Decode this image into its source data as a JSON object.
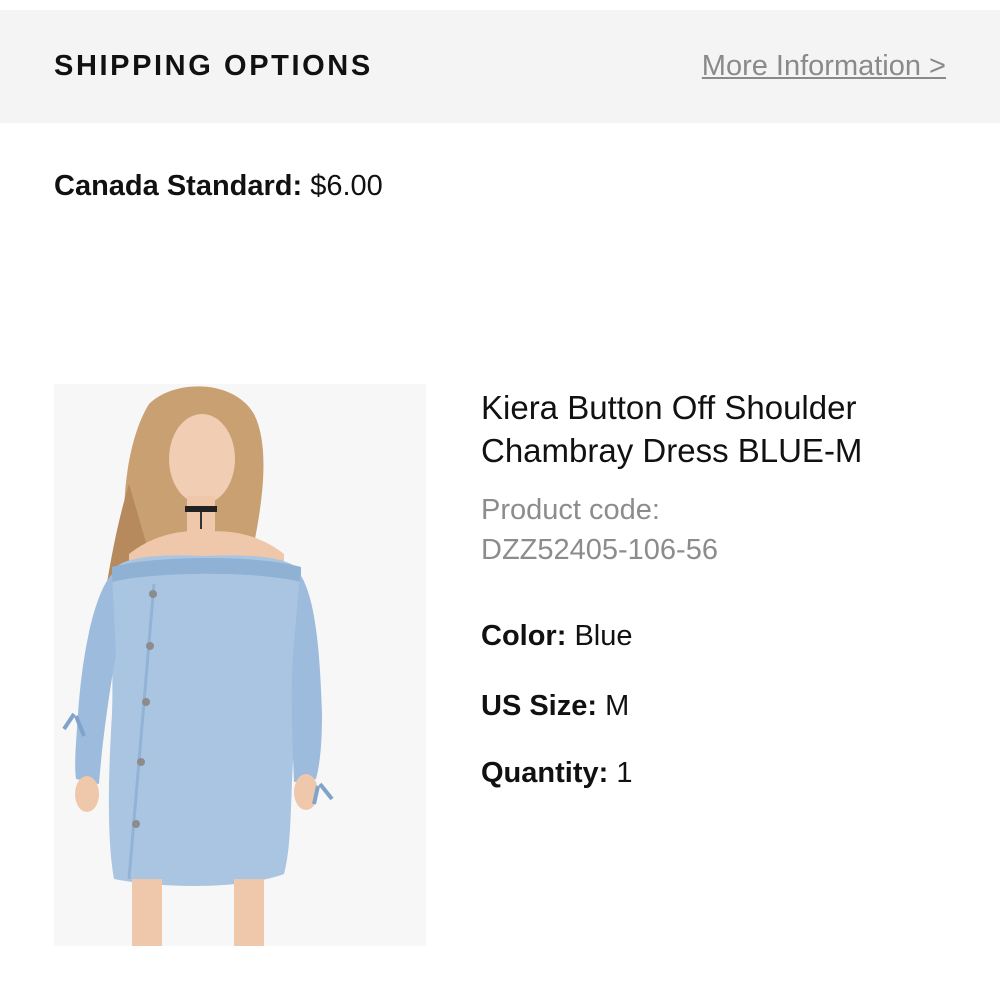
{
  "shipping": {
    "title": "SHIPPING OPTIONS",
    "more_info_link": "More Information >",
    "method_label": "Canada Standard:",
    "method_price": "$6.00"
  },
  "product": {
    "image_icon": "product-photo-dress",
    "name": "Kiera Button Off Shoulder Chambray Dress BLUE-M",
    "code_label": "Product code:",
    "code_value": "DZZ52405-106-56",
    "color_label": "Color:",
    "color_value": "Blue",
    "size_label": "US Size:",
    "size_value": "M",
    "quantity_label": "Quantity:",
    "quantity_value": "1"
  }
}
